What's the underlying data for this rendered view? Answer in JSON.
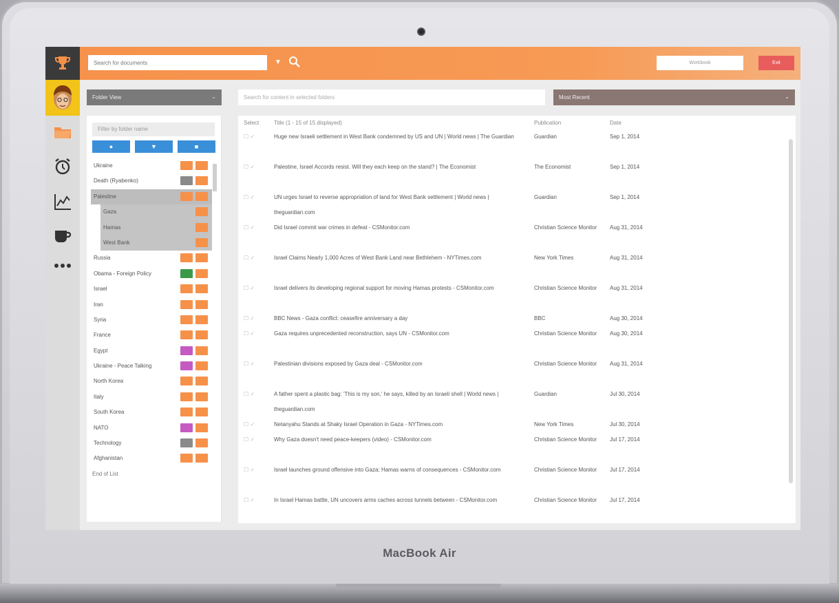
{
  "device": {
    "brand_label": "MacBook Air"
  },
  "topbar": {
    "search_placeholder": "Search for documents",
    "caret_icon": "caret-down-icon",
    "search_icon": "search-icon",
    "white_button_label": "Workbook",
    "red_button_label": "Exit",
    "accent_color": "#f6914a"
  },
  "rail": {
    "items": [
      {
        "name": "trophy-icon"
      },
      {
        "name": "avatar"
      },
      {
        "name": "folder-icon"
      },
      {
        "name": "alarm-clock-icon"
      },
      {
        "name": "line-chart-icon"
      },
      {
        "name": "coffee-icon"
      },
      {
        "name": "more-icon"
      }
    ]
  },
  "left": {
    "view_select": "Folder View",
    "filter_placeholder": "Filter by folder name",
    "toolbar": [
      "add-icon",
      "filter-icon",
      "delete-icon"
    ],
    "tree": [
      {
        "label": "Ukraine",
        "b1": "#f6914a",
        "b2": "#f6914a",
        "level": 0
      },
      {
        "label": "Death (Ryabenko)",
        "b1": "#8a8a8a",
        "b2": "#f6914a",
        "level": 0
      },
      {
        "label": "Palestine",
        "b1": "#f6914a",
        "b2": "#f6914a",
        "level": 0,
        "selected": true
      },
      {
        "label": "Gaza",
        "b1": "",
        "b2": "#f6914a",
        "level": 1
      },
      {
        "label": "Hamas",
        "b1": "",
        "b2": "#f6914a",
        "level": 1
      },
      {
        "label": "West Bank",
        "b1": "",
        "b2": "#f6914a",
        "level": 1
      },
      {
        "label": "Russia",
        "b1": "#f6914a",
        "b2": "#f6914a",
        "level": 0
      },
      {
        "label": "Obama - Foreign Policy",
        "b1": "#3a9a4a",
        "b2": "#f6914a",
        "level": 0
      },
      {
        "label": "Israel",
        "b1": "#f6914a",
        "b2": "#f6914a",
        "level": 0
      },
      {
        "label": "Iran",
        "b1": "#f6914a",
        "b2": "#f6914a",
        "level": 0
      },
      {
        "label": "Syria",
        "b1": "#f6914a",
        "b2": "#f6914a",
        "level": 0
      },
      {
        "label": "France",
        "b1": "#f6914a",
        "b2": "#f6914a",
        "level": 0
      },
      {
        "label": "Egypt",
        "b1": "#c45ac2",
        "b2": "#f6914a",
        "level": 0
      },
      {
        "label": "Ukraine - Peace Talking",
        "b1": "#c45ac2",
        "b2": "#f6914a",
        "level": 0
      },
      {
        "label": "North Korea",
        "b1": "#f6914a",
        "b2": "#f6914a",
        "level": 0
      },
      {
        "label": "Italy",
        "b1": "#f6914a",
        "b2": "#f6914a",
        "level": 0
      },
      {
        "label": "South Korea",
        "b1": "#f6914a",
        "b2": "#f6914a",
        "level": 0
      },
      {
        "label": "NATO",
        "b1": "#c45ac2",
        "b2": "#f6914a",
        "level": 0
      },
      {
        "label": "Technology",
        "b1": "#8a8a8a",
        "b2": "#f6914a",
        "level": 0
      },
      {
        "label": "Afghanistan",
        "b1": "#f6914a",
        "b2": "#f6914a",
        "level": 0
      }
    ],
    "end_label": "End of List"
  },
  "right": {
    "search_placeholder": "Search for content in selected folders",
    "sort_select": "Most Recent",
    "headers": {
      "select": "Select",
      "title": "Title (1 - 15 of 15 displayed)",
      "publication": "Publication",
      "date": "Date"
    },
    "rows": [
      {
        "title": "Huge new Israeli settlement in West Bank condemned by US and UN | World news | The Guardian",
        "pub": "Guardian",
        "date": "Sep 1, 2014",
        "lines": 2
      },
      {
        "title": "Palestine, Israel Accords resist. Will they each keep on the stand? | The Economist",
        "pub": "The Economist",
        "date": "Sep 1, 2014",
        "lines": 2
      },
      {
        "title": "UN urges Israel to reverse appropriation of land for West Bank settlement | World news | theguardian.com",
        "pub": "Guardian",
        "date": "Sep 1, 2014",
        "lines": 2
      },
      {
        "title": "Did Israel commit war crimes in defeat - CSMonitor.com",
        "pub": "Christian Science Monitor",
        "date": "Aug 31, 2014",
        "lines": 2
      },
      {
        "title": "Israel Claims Nearly 1,000 Acres of West Bank Land near Bethlehem - NYTimes.com",
        "pub": "New York Times",
        "date": "Aug 31, 2014",
        "lines": 2
      },
      {
        "title": "Israel delivers its developing regional support for moving Hamas protests - CSMonitor.com",
        "pub": "Christian Science Monitor",
        "date": "Aug 31, 2014",
        "lines": 2
      },
      {
        "title": "BBC News - Gaza conflict: ceasefire anniversary a day",
        "pub": "BBC",
        "date": "Aug 30, 2014",
        "lines": 1
      },
      {
        "title": "Gaza requires unprecedented reconstruction, says UN - CSMonitor.com",
        "pub": "Christian Science Monitor",
        "date": "Aug 30, 2014",
        "lines": 2
      },
      {
        "title": "Palestinian divisions exposed by Gaza deal - CSMonitor.com",
        "pub": "Christian Science Monitor",
        "date": "Aug 31, 2014",
        "lines": 2
      },
      {
        "title": "A father spent a plastic bag: 'This is my son,' he says, killed by an Israeli shell | World news | theguardian.com",
        "pub": "Guardian",
        "date": "Jul 30, 2014",
        "lines": 2
      },
      {
        "title": "Netanyahu Stands at Shaky Israel Operation in Gaza - NYTimes.com",
        "pub": "New York Times",
        "date": "Jul 30, 2014",
        "lines": 1
      },
      {
        "title": "Why Gaza doesn't need peace-keepers (video) - CSMonitor.com",
        "pub": "Christian Science Monitor",
        "date": "Jul 17, 2014",
        "lines": 2
      },
      {
        "title": "Israel launches ground offensive into Gaza; Hamas warns of consequences - CSMonitor.com",
        "pub": "Christian Science Monitor",
        "date": "Jul 17, 2014",
        "lines": 2
      },
      {
        "title": "In Israel Hamas battle, UN uncovers arms caches across tunnels between - CSMonitor.com",
        "pub": "Christian Science Monitor",
        "date": "Jul 17, 2014",
        "lines": 2
      }
    ]
  }
}
